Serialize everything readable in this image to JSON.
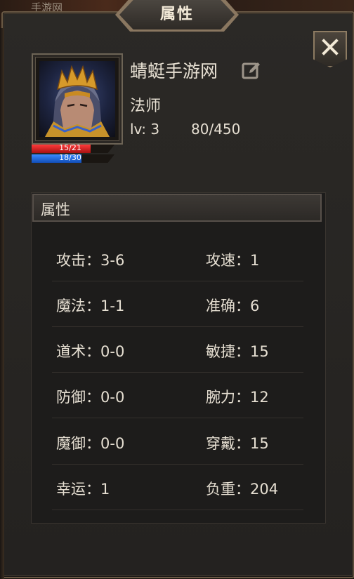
{
  "background": {
    "partial_title": "手游网"
  },
  "window": {
    "title": "属性"
  },
  "close_button": {
    "label": "X"
  },
  "character": {
    "name": "蜻蜓手游网",
    "class": "法师",
    "level_text": "lv: 3",
    "exp_text": "80/450",
    "hp": {
      "text": "15/21",
      "current": 15,
      "max": 21
    },
    "mp": {
      "text": "18/30",
      "current": 18,
      "max": 30
    }
  },
  "attributes_section": {
    "header": "属性",
    "rows": [
      {
        "left": "攻击：3-6",
        "right": "攻速：1"
      },
      {
        "left": "魔法：1-1",
        "right": "准确：6"
      },
      {
        "left": "道术：0-0",
        "right": "敏捷：15"
      },
      {
        "left": "防御：0-0",
        "right": "腕力：12"
      },
      {
        "left": "魔御：0-0",
        "right": "穿戴：15"
      },
      {
        "left": "幸运：1",
        "right": "负重：204"
      }
    ]
  },
  "colors": {
    "hp": "#d81f1f",
    "mp": "#2a6fe0",
    "gold_accent": "#8a7760"
  }
}
